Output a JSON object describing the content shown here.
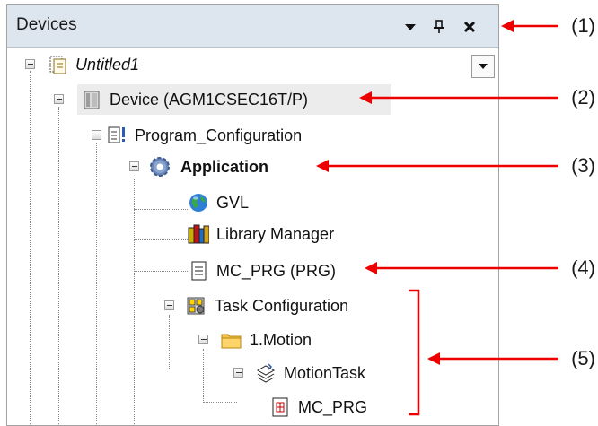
{
  "panel": {
    "title": "Devices",
    "buttons": {
      "menu_icon": "dropdown-arrow",
      "pin_icon": "pin",
      "close_icon": "close"
    }
  },
  "tree": {
    "root": "Untitled1",
    "device": "Device (AGM1CSEC16T/P)",
    "program_configuration": "Program_Configuration",
    "application": "Application",
    "gvl": "GVL",
    "library_manager": "Library Manager",
    "mc_prg": "MC_PRG (PRG)",
    "task_configuration": "Task Configuration",
    "motion_folder": "1.Motion",
    "motion_task": "MotionTask",
    "task_call": "MC_PRG"
  },
  "callouts": {
    "c1": "(1)",
    "c2": "(2)",
    "c3": "(3)",
    "c4": "(4)",
    "c5": "(5)"
  },
  "colors": {
    "callout_arrow": "#ee0000",
    "titlebar": "#dde6ee",
    "highlight_row": "#ececec"
  }
}
